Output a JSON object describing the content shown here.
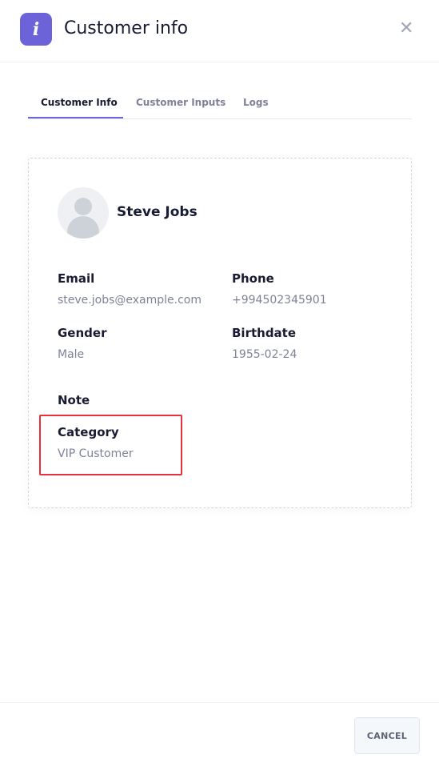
{
  "header": {
    "icon_glyph": "i",
    "title": "Customer info",
    "close_glyph": "✕",
    "accent": "#6c63d8"
  },
  "tabs": [
    {
      "label": "Customer Info",
      "active": true
    },
    {
      "label": "Customer Inputs",
      "active": false
    },
    {
      "label": "Logs",
      "active": false
    }
  ],
  "customer": {
    "name": "Steve Jobs",
    "fields": {
      "email": {
        "label": "Email",
        "value": "steve.jobs@example.com"
      },
      "phone": {
        "label": "Phone",
        "value": "+994502345901"
      },
      "gender": {
        "label": "Gender",
        "value": "Male"
      },
      "birthdate": {
        "label": "Birthdate",
        "value": "1955-02-24"
      },
      "note": {
        "label": "Note",
        "value": ""
      },
      "category": {
        "label": "Category",
        "value": "VIP Customer"
      }
    }
  },
  "footer": {
    "cancel_label": "CANCEL"
  },
  "colors": {
    "highlight_border": "#e8303e"
  }
}
